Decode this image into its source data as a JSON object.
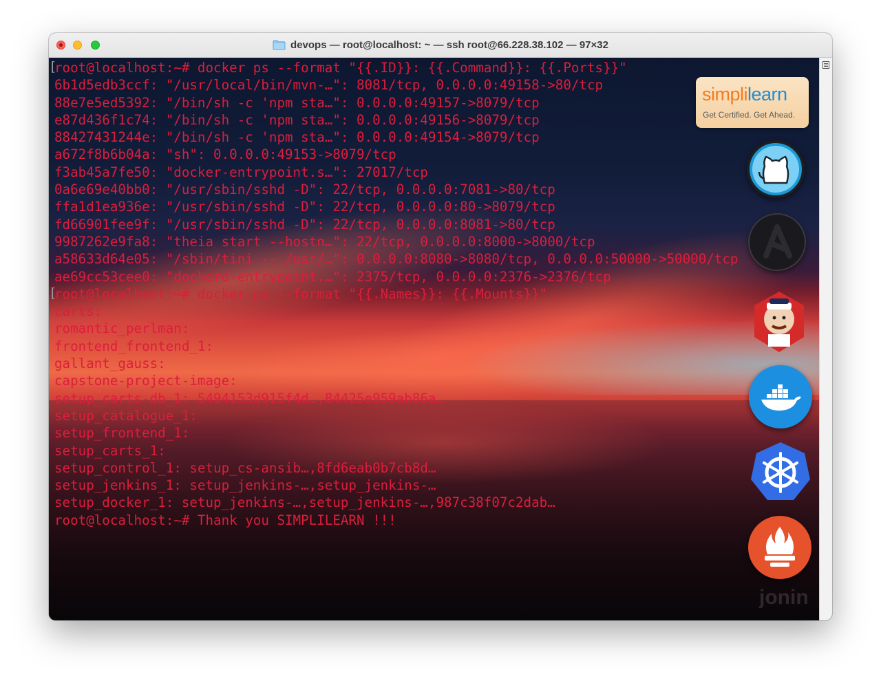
{
  "window": {
    "title": "devops — root@localhost: ~ — ssh root@66.228.38.102 — 97×32"
  },
  "terminal": {
    "lines": [
      "root@localhost:~# docker ps --format \"{{.ID}}: {{.Command}}: {{.Ports}}\"",
      "6b1d5edb3ccf: \"/usr/local/bin/mvn-…\": 8081/tcp, 0.0.0.0:49158->80/tcp",
      "88e7e5ed5392: \"/bin/sh -c 'npm sta…\": 0.0.0.0:49157->8079/tcp",
      "e87d436f1c74: \"/bin/sh -c 'npm sta…\": 0.0.0.0:49156->8079/tcp",
      "88427431244e: \"/bin/sh -c 'npm sta…\": 0.0.0.0:49154->8079/tcp",
      "a672f8b6b04a: \"sh\": 0.0.0.0:49153->8079/tcp",
      "f3ab45a7fe50: \"docker-entrypoint.s…\": 27017/tcp",
      "0a6e69e40bb0: \"/usr/sbin/sshd -D\": 22/tcp, 0.0.0.0:7081->80/tcp",
      "ffa1d1ea936e: \"/usr/sbin/sshd -D\": 22/tcp, 0.0.0.0:80->8079/tcp",
      "fd66901fee9f: \"/usr/sbin/sshd -D\": 22/tcp, 0.0.0.0:8081->80/tcp",
      "9987262e9fa8: \"theia start --hostn…\": 22/tcp, 0.0.0.0:8000->8000/tcp",
      "a58633d64e05: \"/sbin/tini -- /usr/…\": 0.0.0.0:8080->8080/tcp, 0.0.0.0:50000->50000/tcp",
      "ae69cc53cee0: \"dockerd-entrypoint.…\": 2375/tcp, 0.0.0.0:2376->2376/tcp",
      "root@localhost:~# docker ps --format \"{{.Names}}: {{.Mounts}}\"",
      "carts:",
      "romantic_perlman:",
      "frontend_frontend_1:",
      "gallant_gauss:",
      "capstone-project-image:",
      "setup_carts-db_1: 5494153d915f4d…,84425e959ab86a…",
      "setup_catalogue_1:",
      "setup_frontend_1:",
      "setup_carts_1:",
      "setup_control_1: setup_cs-ansib…,8fd6eab0b7cb8d…",
      "setup_jenkins_1: setup_jenkins-…,setup_jenkins-…",
      "setup_docker_1: setup_jenkins-…,setup_jenkins-…,987c38f07c2dab…",
      "root@localhost:~# Thank you SIMPLILEARN !!!"
    ],
    "text_color": "#dc1e3c"
  },
  "wallpaper": {
    "brand_simpli": "simpl",
    "brand_i": "i",
    "brand_learn": "learn",
    "tagline": "Get Certified. Get Ahead.",
    "watermark": "jonin",
    "icons": [
      "github-icon",
      "ansible-icon",
      "jenkins-icon",
      "docker-icon",
      "kubernetes-icon",
      "prometheus-icon"
    ]
  }
}
